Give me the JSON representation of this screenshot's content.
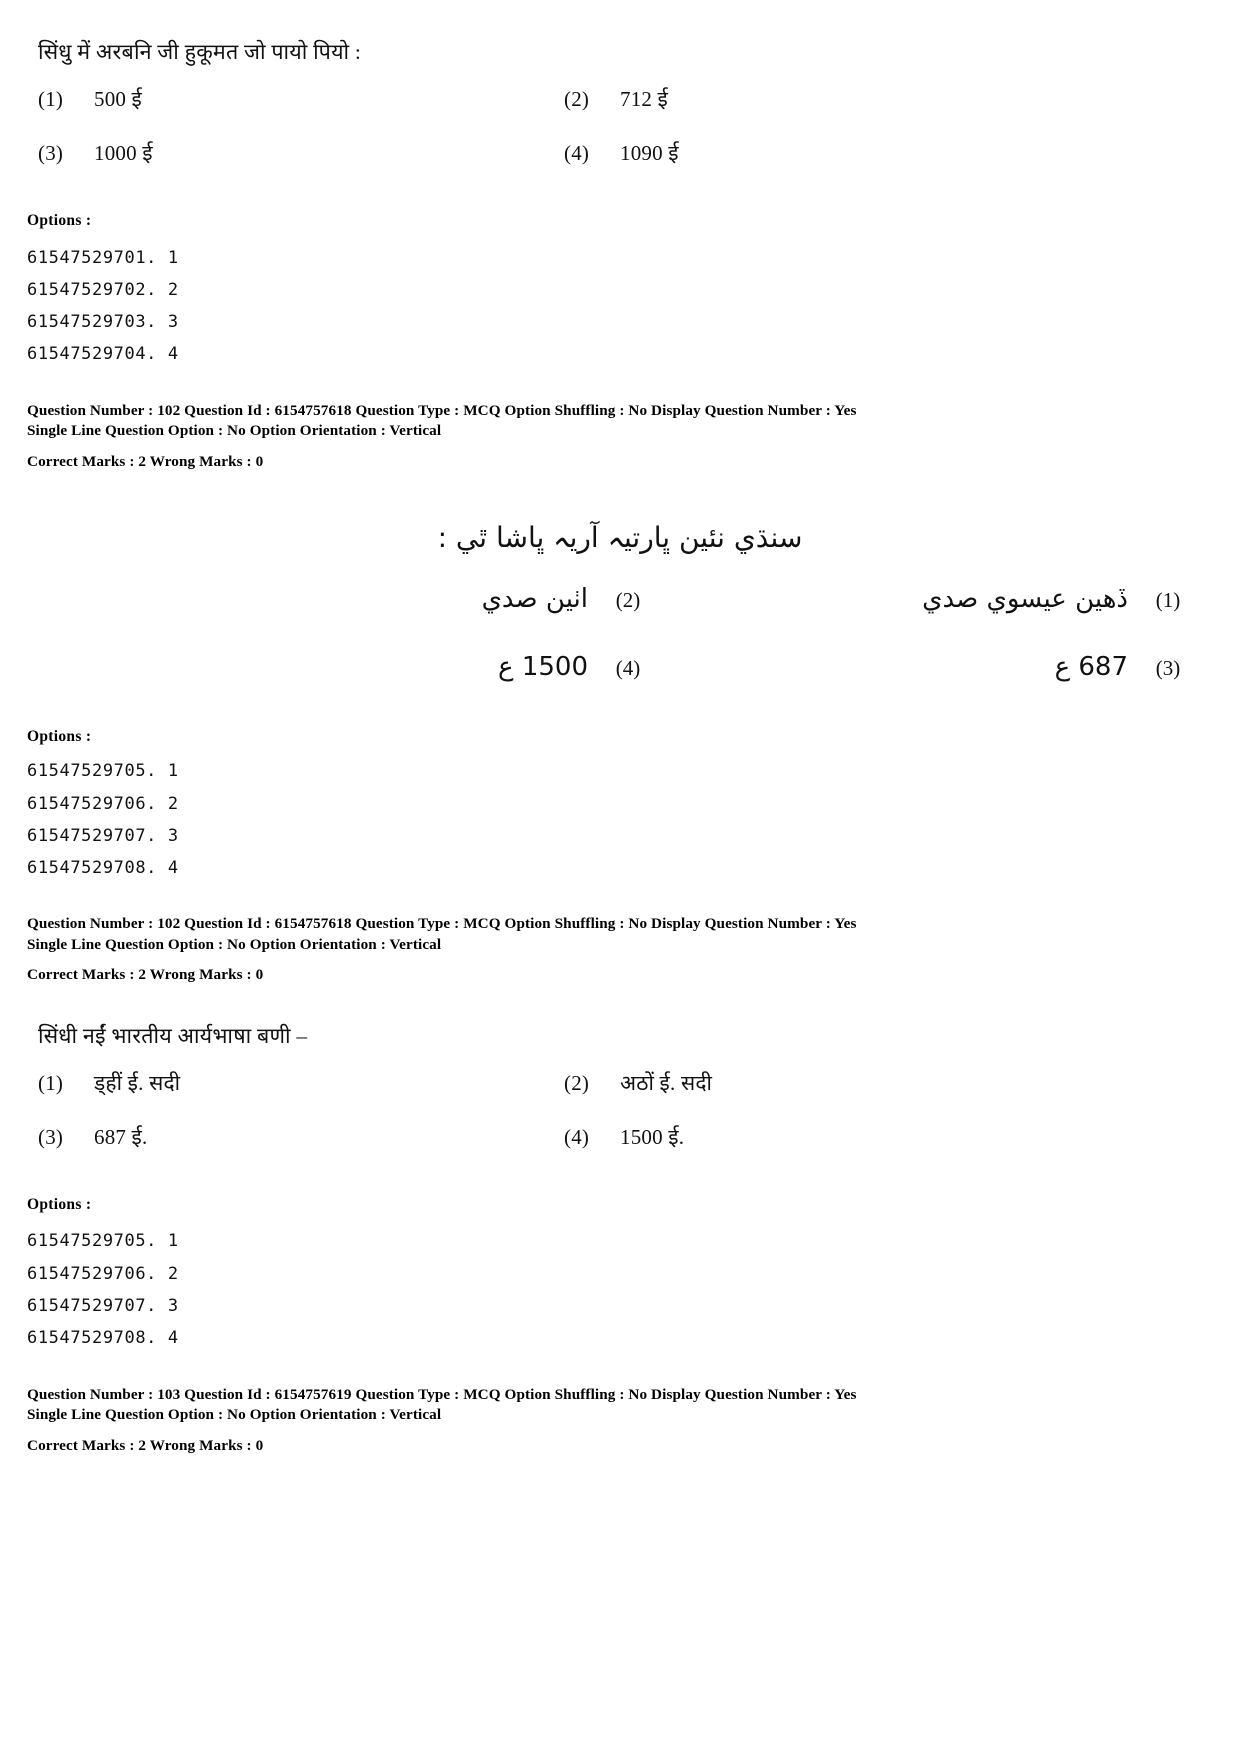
{
  "page": {
    "document_type": "exam-question-paper-scan"
  },
  "blocks": [
    {
      "script": "devanagari",
      "stem": "सिंधु में अरबनि जी हुकूमत जो पायो पियो  :",
      "options": [
        {
          "num": "(1)",
          "text": "500 ई"
        },
        {
          "num": "(2)",
          "text": "712 ई"
        },
        {
          "num": "(3)",
          "text": "1000 ई"
        },
        {
          "num": "(4)",
          "text": "1090 ई"
        }
      ],
      "options_label": "Options :",
      "option_ids": [
        "61547529701. 1",
        "61547529702. 2",
        "61547529703. 3",
        "61547529704. 4"
      ],
      "meta_line1": "Question Number : 102  Question Id : 6154757618  Question Type : MCQ  Option Shuffling : No  Display Question Number : Yes",
      "meta_line2": "Single Line Question Option : No  Option Orientation : Vertical",
      "meta_marks": "Correct Marks : 2  Wrong Marks : 0"
    },
    {
      "script": "arabic",
      "stem": "سنڌي نئين ڀارتيہ آريہ ڀاشا ٿي :",
      "options": [
        {
          "num": "(1)",
          "text": "ڏهين عيسوي صدي"
        },
        {
          "num": "(2)",
          "text": "اٺين صدي"
        },
        {
          "num": "(3)",
          "text": "687 ع"
        },
        {
          "num": "(4)",
          "text": "1500 ع"
        }
      ],
      "options_label": "Options :",
      "option_ids": [
        "61547529705. 1",
        "61547529706. 2",
        "61547529707. 3",
        "61547529708. 4"
      ],
      "meta_line1": "Question Number : 102  Question Id : 6154757618  Question Type : MCQ  Option Shuffling : No  Display Question Number : Yes",
      "meta_line2": "Single Line Question Option : No  Option Orientation : Vertical",
      "meta_marks": "Correct Marks : 2  Wrong Marks : 0"
    },
    {
      "script": "devanagari",
      "stem": "सिंधी नईं भारतीय आर्यभाषा बणी –",
      "options": [
        {
          "num": "(1)",
          "text": "ड्हीं ई. सदी"
        },
        {
          "num": "(2)",
          "text": "अठों ई. सदी"
        },
        {
          "num": "(3)",
          "text": "687 ई."
        },
        {
          "num": "(4)",
          "text": "1500 ई."
        }
      ],
      "options_label": "Options :",
      "option_ids": [
        "61547529705. 1",
        "61547529706. 2",
        "61547529707. 3",
        "61547529708. 4"
      ],
      "meta_line1": "Question Number : 103  Question Id : 6154757619  Question Type : MCQ  Option Shuffling : No  Display Question Number : Yes",
      "meta_line2": "Single Line Question Option : No  Option Orientation : Vertical",
      "meta_marks": "Correct Marks : 2  Wrong Marks : 0"
    }
  ]
}
